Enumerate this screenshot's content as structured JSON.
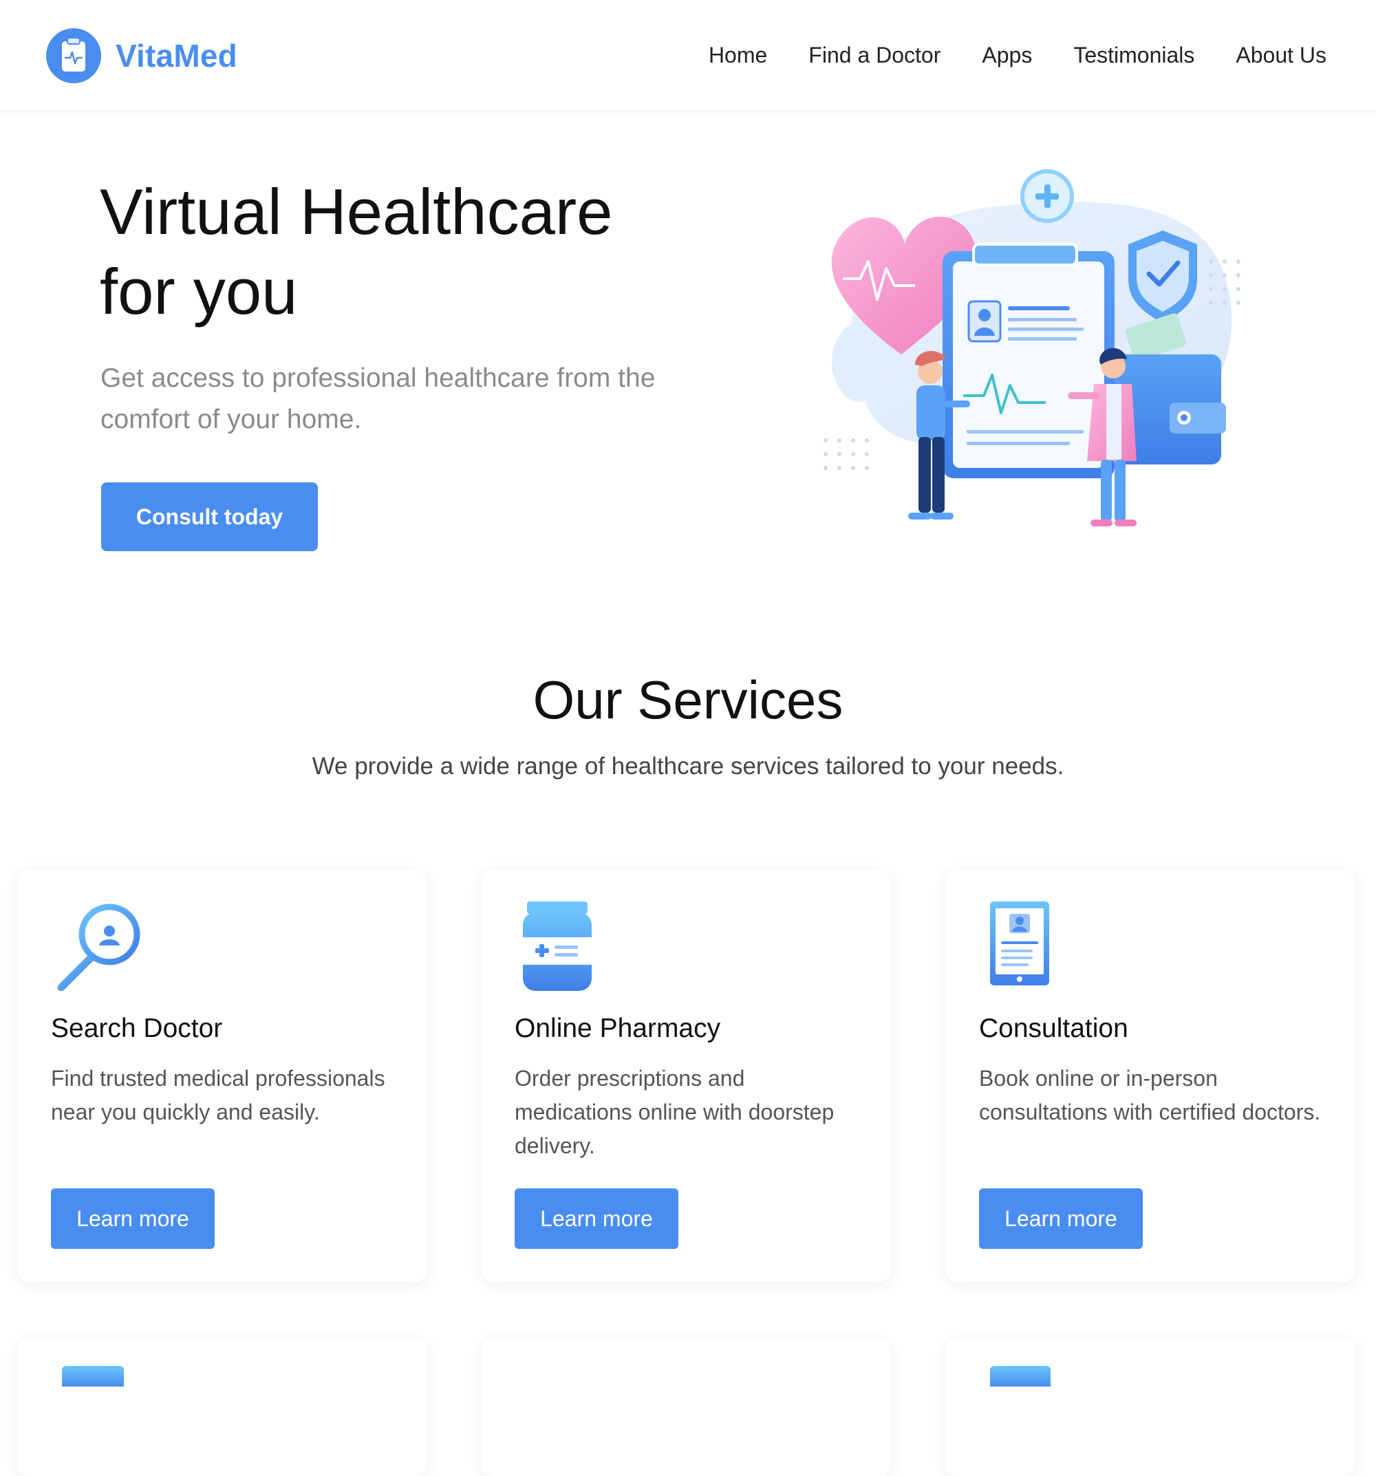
{
  "header": {
    "brand_name": "VitaMed",
    "nav": [
      {
        "label": "Home"
      },
      {
        "label": "Find a Doctor"
      },
      {
        "label": "Apps"
      },
      {
        "label": "Testimonials"
      },
      {
        "label": "About Us"
      }
    ]
  },
  "hero": {
    "title_line1": "Virtual Healthcare",
    "title_line2": "for you",
    "subtitle": "Get access to professional healthcare from the comfort of your home.",
    "cta_label": "Consult today"
  },
  "services": {
    "title": "Our Services",
    "subtitle": "We provide a wide range of healthcare services tailored to your needs.",
    "cards": [
      {
        "icon": "search-doctor-icon",
        "title": "Search Doctor",
        "description": "Find trusted medical professionals near you quickly and easily.",
        "button_label": "Learn more"
      },
      {
        "icon": "pharmacy-bottle-icon",
        "title": "Online Pharmacy",
        "description": "Order prescriptions and medications online with doorstep delivery.",
        "button_label": "Learn more"
      },
      {
        "icon": "consultation-tablet-icon",
        "title": "Consultation",
        "description": "Book online or in-person consultations with certified doctors.",
        "button_label": "Learn more"
      }
    ]
  },
  "colors": {
    "accent": "#4a8df0",
    "heading": "#111111",
    "muted_text": "#8a8a8a",
    "pink": "#f49ac8"
  }
}
